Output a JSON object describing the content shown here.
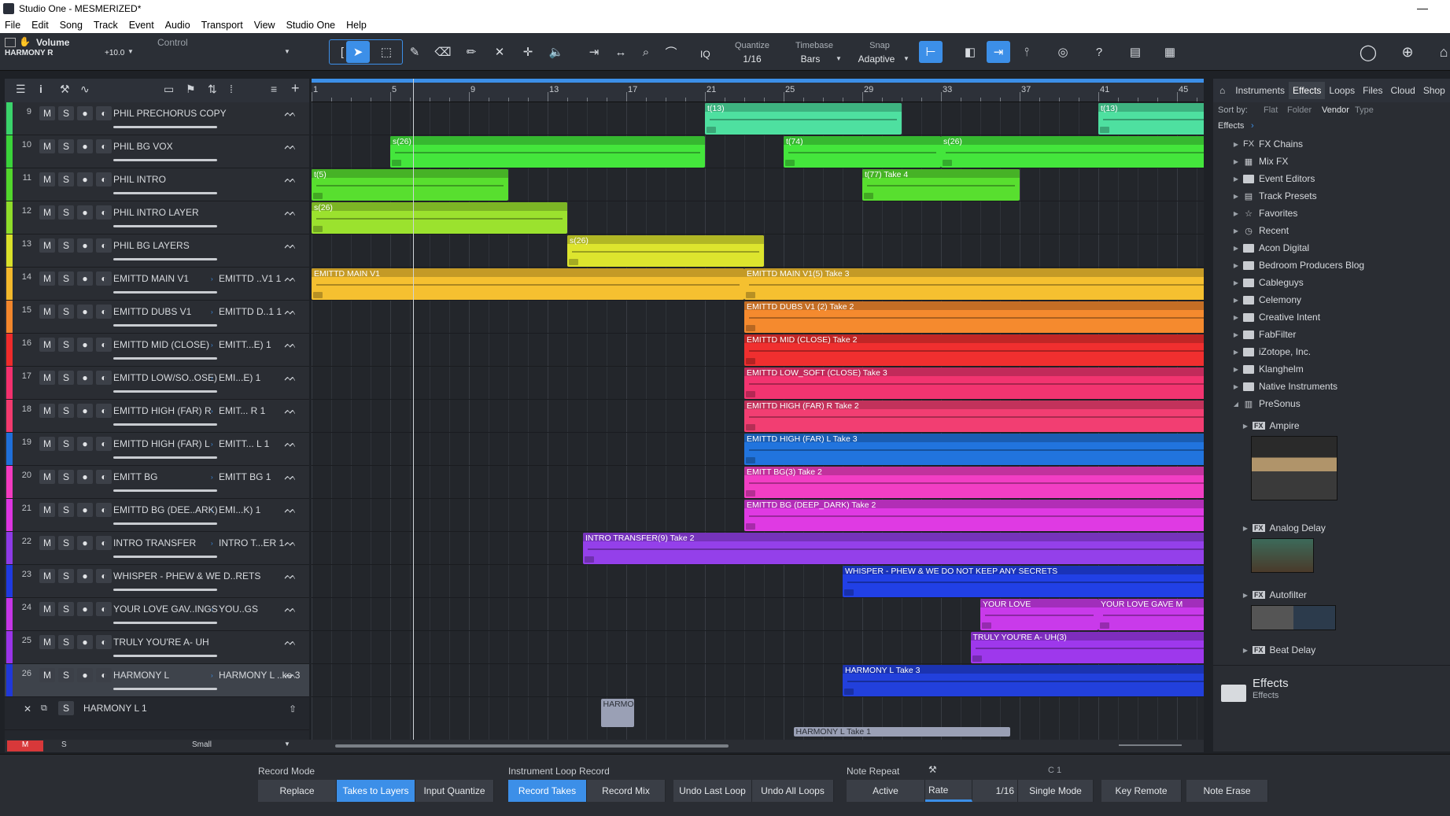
{
  "window": {
    "title": "Studio One - MESMERIZED*"
  },
  "menu": [
    "File",
    "Edit",
    "Song",
    "Track",
    "Event",
    "Audio",
    "Transport",
    "View",
    "Studio One",
    "Help"
  ],
  "toolbar": {
    "param_name": "Volume",
    "param_track": "HARMONY R",
    "param_value": "+10.0",
    "control_label": "Control",
    "quantize_label": "Quantize",
    "quantize_value": "1/16",
    "timebase_label": "Timebase",
    "timebase_value": "Bars",
    "snap_label": "Snap",
    "snap_value": "Adaptive",
    "iq_label": "IQ",
    "help_label": "?"
  },
  "ruler": {
    "bars": [
      "1",
      "5",
      "9",
      "13",
      "17",
      "21",
      "25",
      "29",
      "33",
      "37",
      "41",
      "45"
    ]
  },
  "tracks": [
    {
      "num": "9",
      "name": "PHIL PRECHORUS COPY",
      "layer": "",
      "color": "#3ad36b"
    },
    {
      "num": "10",
      "name": "PHIL BG VOX",
      "layer": "",
      "color": "#3ad33a"
    },
    {
      "num": "11",
      "name": "PHIL INTRO",
      "layer": "",
      "color": "#52d62c"
    },
    {
      "num": "12",
      "name": "PHIL INTRO LAYER",
      "layer": "",
      "color": "#8fdc2a"
    },
    {
      "num": "13",
      "name": "PHIL BG LAYERS",
      "layer": "",
      "color": "#d9e02a"
    },
    {
      "num": "14",
      "name": "EMITTD MAIN V1",
      "layer": "EMITTD ..V1 1",
      "color": "#f2b82c"
    },
    {
      "num": "15",
      "name": "EMITTD DUBS V1",
      "layer": "EMITTD D..1 1",
      "color": "#f2862c"
    },
    {
      "num": "16",
      "name": "EMITTD MID (CLOSE)",
      "layer": "EMITT...E) 1",
      "color": "#ee2b2b"
    },
    {
      "num": "17",
      "name": "EMITTD LOW/SO..OSE)",
      "layer": "EMI...E) 1",
      "color": "#f2306d"
    },
    {
      "num": "18",
      "name": "EMITTD HIGH (FAR) R",
      "layer": "EMIT... R 1",
      "color": "#f23a6e"
    },
    {
      "num": "19",
      "name": "EMITTD HIGH (FAR) L",
      "layer": "EMITT... L 1",
      "color": "#1f6fd9"
    },
    {
      "num": "20",
      "name": "EMITT BG",
      "layer": "EMITT BG 1",
      "color": "#f23abf"
    },
    {
      "num": "21",
      "name": "EMITTD BG (DEE..ARK)",
      "layer": "EMI...K) 1",
      "color": "#dc35e0"
    },
    {
      "num": "22",
      "name": "INTRO TRANSFER",
      "layer": "INTRO T...ER 1",
      "color": "#8e3ae6"
    },
    {
      "num": "23",
      "name": "WHISPER - PHEW & WE D..RETS",
      "layer": "",
      "color": "#1f3ae0"
    },
    {
      "num": "24",
      "name": "YOUR LOVE GAV..INGS",
      "layer": "YOU..GS",
      "color": "#c536e6"
    },
    {
      "num": "25",
      "name": "TRULY YOU'RE A- UH",
      "layer": "",
      "color": "#9a34e8"
    },
    {
      "num": "26",
      "name": "HARMONY L",
      "layer": "HARMONY L ..ke 3",
      "color": "#2038d8"
    }
  ],
  "layer_row": {
    "name": "HARMONY L 1",
    "s": "S"
  },
  "track_btns": {
    "m": "M",
    "s": "S"
  },
  "bottom_strip": {
    "m": "M",
    "s": "S",
    "size": "Small"
  },
  "clips": [
    {
      "lane": 0,
      "start": 21,
      "len": 10,
      "label": "t(13)",
      "color": "#4ee0a0"
    },
    {
      "lane": 0,
      "start": 41,
      "len": 11,
      "label": "t(13)",
      "color": "#4ee0a0"
    },
    {
      "lane": 1,
      "start": 5,
      "len": 16,
      "label": "s(26)",
      "color": "#44e63c"
    },
    {
      "lane": 1,
      "start": 25,
      "len": 8,
      "label": "t(74)",
      "color": "#44e63c"
    },
    {
      "lane": 1,
      "start": 33,
      "len": 16,
      "label": "s(26)",
      "color": "#44e63c"
    },
    {
      "lane": 2,
      "start": 1,
      "len": 10,
      "label": "t(5)",
      "color": "#58df2f"
    },
    {
      "lane": 2,
      "start": 29,
      "len": 8,
      "label": "t(77) Take 4",
      "color": "#58df2f"
    },
    {
      "lane": 3,
      "start": 1,
      "len": 13,
      "label": "s(26)",
      "color": "#9be22e"
    },
    {
      "lane": 4,
      "start": 14,
      "len": 10,
      "label": "s(26)",
      "color": "#dde52e"
    },
    {
      "lane": 5,
      "start": 1,
      "len": 22,
      "label": "EMITTD MAIN V1",
      "color": "#f5c030"
    },
    {
      "lane": 5,
      "start": 23,
      "len": 28,
      "label": "EMITTD MAIN V1(5) Take 3",
      "color": "#f5c030"
    },
    {
      "lane": 6,
      "start": 23,
      "len": 28,
      "label": "EMITTD DUBS V1 (2) Take 2",
      "color": "#f58a2e"
    },
    {
      "lane": 7,
      "start": 23,
      "len": 28,
      "label": "EMITTD MID (CLOSE) Take 2",
      "color": "#f02f2f"
    },
    {
      "lane": 8,
      "start": 23,
      "len": 28,
      "label": "EMITTD LOW_SOFT (CLOSE) Take 3",
      "color": "#f23470"
    },
    {
      "lane": 9,
      "start": 23,
      "len": 28,
      "label": "EMITTD HIGH (FAR) R Take 2",
      "color": "#f23e72"
    },
    {
      "lane": 10,
      "start": 23,
      "len": 28,
      "label": "EMITTD HIGH (FAR) L Take 3",
      "color": "#2174de"
    },
    {
      "lane": 11,
      "start": 23,
      "len": 28,
      "label": "EMITT BG(3) Take 2",
      "color": "#f23ec4"
    },
    {
      "lane": 12,
      "start": 23,
      "len": 28,
      "label": "EMITTD BG (DEEP_DARK) Take 2",
      "color": "#df3ae3"
    },
    {
      "lane": 13,
      "start": 14.8,
      "len": 36.2,
      "label": "INTRO TRANSFER(9) Take 2",
      "color": "#9440ea"
    },
    {
      "lane": 14,
      "start": 28,
      "len": 23,
      "label": "WHISPER - PHEW & WE DO NOT KEEP ANY SECRETS",
      "color": "#2140e6"
    },
    {
      "lane": 15,
      "start": 35,
      "len": 6,
      "label": "YOUR LOVE",
      "color": "#c93aea"
    },
    {
      "lane": 15,
      "start": 41,
      "len": 10,
      "label": "YOUR LOVE GAVE M",
      "color": "#c93aea"
    },
    {
      "lane": 16,
      "start": 34.5,
      "len": 16.5,
      "label": "TRULY YOU'RE A- UH(3)",
      "color": "#9e38ec"
    },
    {
      "lane": 17,
      "start": 28,
      "len": 23,
      "label": "HARMONY L Take 3",
      "color": "#2240dc"
    }
  ],
  "extra_clips": {
    "harmo": "HARMO",
    "harmony_take1": "HARMONY L Take 1"
  },
  "browser": {
    "tabs": [
      "Instruments",
      "Effects",
      "Loops",
      "Files",
      "Cloud",
      "Shop"
    ],
    "active_tab": "Effects",
    "sort_by": "Sort by:",
    "sort_options": [
      "Flat",
      "Folder",
      "Vendor",
      "Type"
    ],
    "breadcrumb": "Effects",
    "items": [
      {
        "label": "FX Chains",
        "icon": "fx-chains-icon"
      },
      {
        "label": "Mix FX",
        "icon": "mix-fx-icon"
      },
      {
        "label": "Event Editors",
        "icon": "folder-icon"
      },
      {
        "label": "Track Presets",
        "icon": "track-presets-icon"
      },
      {
        "label": "Favorites",
        "icon": "star-icon"
      },
      {
        "label": "Recent",
        "icon": "clock-icon"
      },
      {
        "label": "Acon Digital",
        "icon": "folder-icon"
      },
      {
        "label": "Bedroom Producers Blog",
        "icon": "folder-icon"
      },
      {
        "label": "Cableguys",
        "icon": "folder-icon"
      },
      {
        "label": "Celemony",
        "icon": "folder-icon"
      },
      {
        "label": "Creative Intent",
        "icon": "folder-icon"
      },
      {
        "label": "FabFilter",
        "icon": "folder-icon"
      },
      {
        "label": "iZotope, Inc.",
        "icon": "folder-icon"
      },
      {
        "label": "Klanghelm",
        "icon": "folder-icon"
      },
      {
        "label": "Native Instruments",
        "icon": "folder-icon"
      },
      {
        "label": "PreSonus",
        "icon": "presonus-icon"
      }
    ],
    "presonus_children": [
      "Ampire",
      "Analog Delay",
      "Autofilter",
      "Beat Delay"
    ],
    "fx_badge": "FX",
    "footer_title": "Effects",
    "footer_sub": "Effects"
  },
  "record_panel": {
    "record_mode_title": "Record Mode",
    "record_mode_btns": [
      "Replace",
      "Takes to Layers",
      "Input Quantize"
    ],
    "loop_title": "Instrument Loop Record",
    "loop_btns": [
      "Record Takes",
      "Record Mix",
      "Undo Last Loop",
      "Undo All Loops"
    ],
    "note_repeat_title": "Note Repeat",
    "note_label": "C 1",
    "note_btns": [
      "Active",
      "Rate",
      "1/16",
      "Single Mode",
      "Key Remote",
      "Note Erase"
    ]
  }
}
